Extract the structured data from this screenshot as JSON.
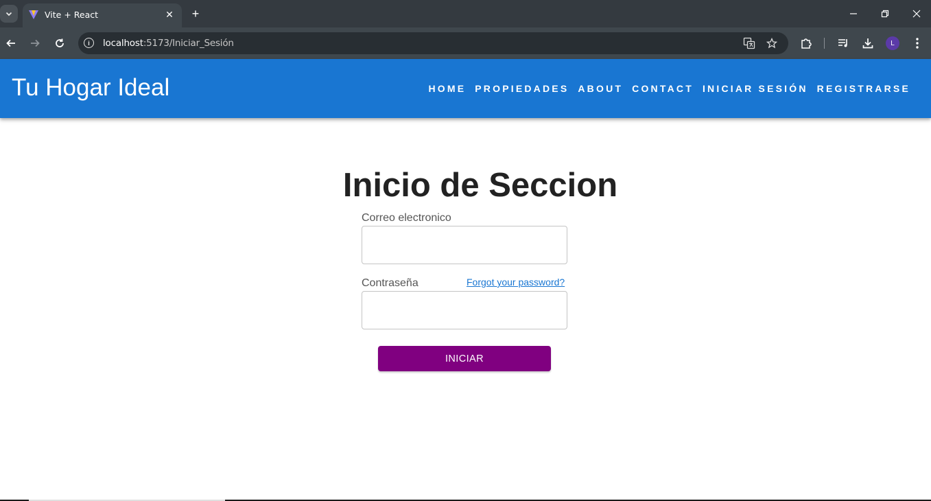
{
  "browser": {
    "tab_title": "Vite + React",
    "url_host": "localhost",
    "url_path": ":5173/Iniciar_Sesión",
    "avatar_letter": "L"
  },
  "header": {
    "brand": "Tu Hogar Ideal",
    "nav": [
      "HOME",
      "PROPIEDADES",
      "ABOUT",
      "CONTACT",
      "INICIAR SESIÓN",
      "REGISTRARSE"
    ]
  },
  "form": {
    "title": "Inicio de Seccion",
    "email_label": "Correo electronico",
    "email_value": "",
    "password_label": "Contraseña",
    "password_value": "",
    "forgot_link": "Forgot your password?",
    "submit_label": "INICIAR"
  },
  "colors": {
    "appbar": "#1976d2",
    "submit": "#800080",
    "link": "#1976d2"
  }
}
